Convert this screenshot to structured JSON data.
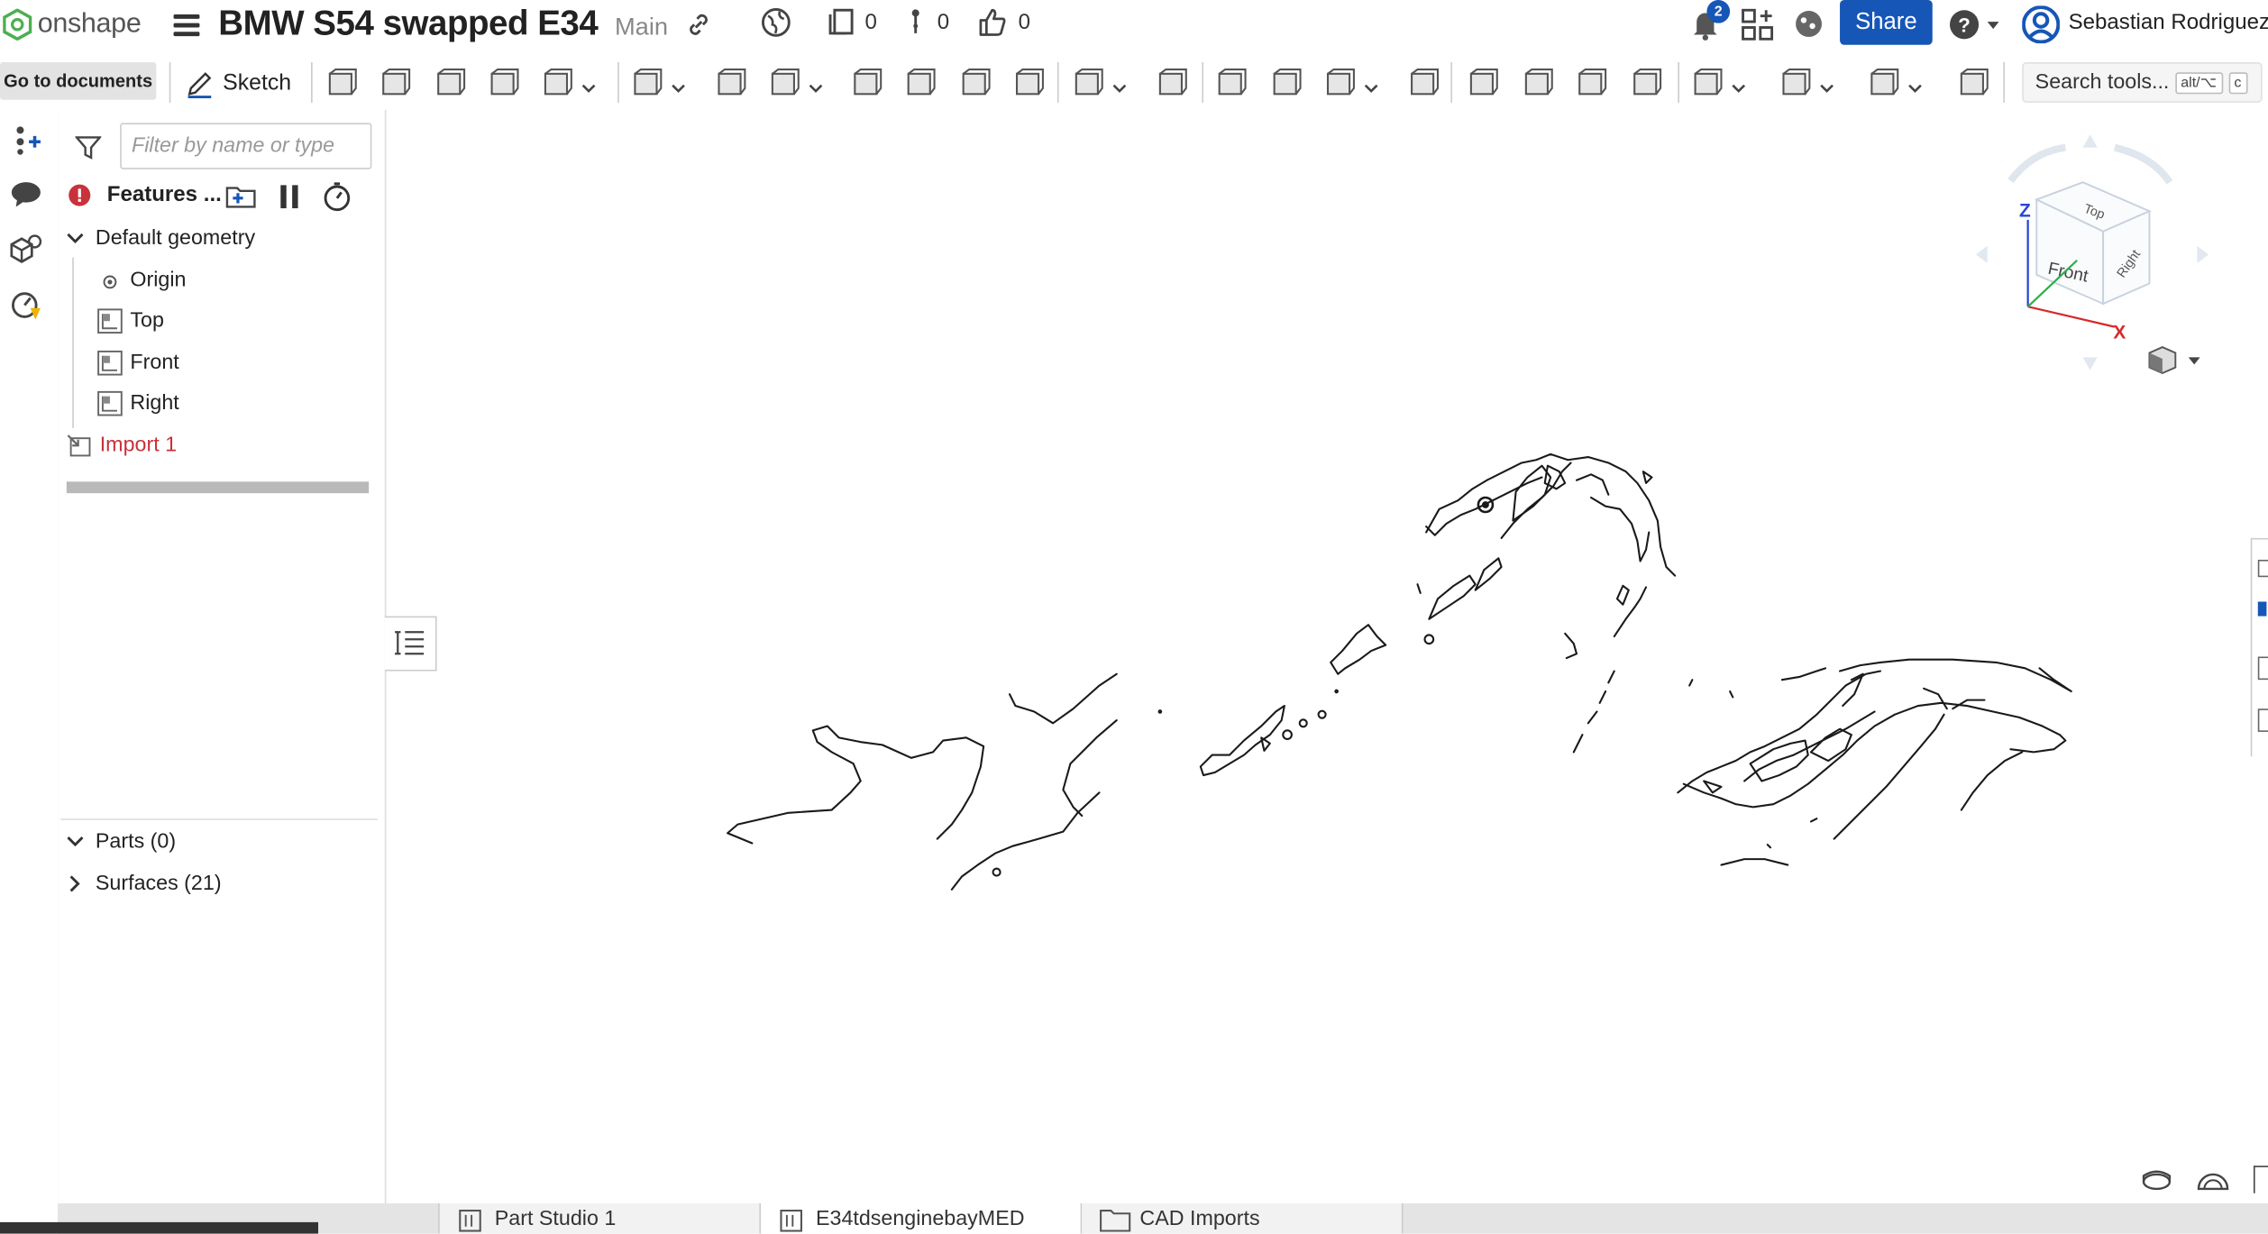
{
  "header": {
    "logo_text": "onshape",
    "document_title": "BMW S54 swapped E34",
    "branch": "Main",
    "versions_count": "0",
    "branches_count": "0",
    "likes_count": "0",
    "notifications_count": "2",
    "share_label": "Share",
    "user_name": "Sebastian Rodriguez"
  },
  "toolbar": {
    "go_to_documents": "Go to documents",
    "sketch_label": "Sketch",
    "search_label": "Search tools...",
    "search_kbd_1": "alt/⌥",
    "search_kbd_2": "c"
  },
  "feature_panel": {
    "filter_placeholder": "Filter by name or type",
    "features_title": "Features ...",
    "default_geometry": "Default geometry",
    "origin": "Origin",
    "planes": [
      "Top",
      "Front",
      "Right"
    ],
    "import_item": "Import 1",
    "parts_label": "Parts (0)",
    "surfaces_label": "Surfaces (21)"
  },
  "viewcube": {
    "top": "Top",
    "front": "Front",
    "right": "Right",
    "axis_z": "Z",
    "axis_x": "X"
  },
  "bottom_tabs": [
    {
      "label": "Part Studio 1"
    },
    {
      "label": "E34tdsenginebayMED"
    },
    {
      "label": "CAD Imports"
    }
  ],
  "colors": {
    "brand_blue": "#1656b7",
    "error_red": "#c8323a",
    "logo_green": "#4caf50"
  }
}
